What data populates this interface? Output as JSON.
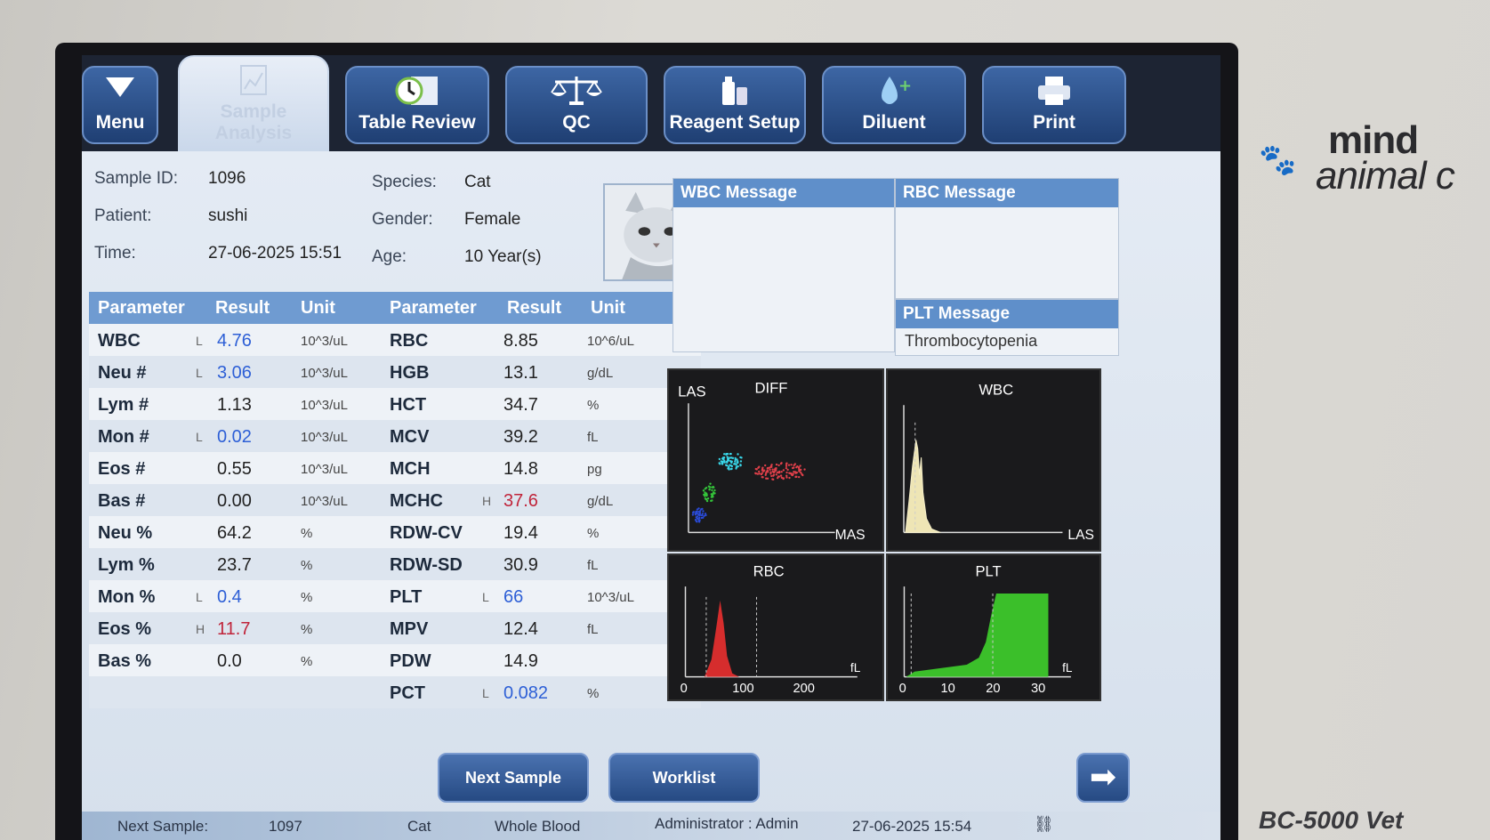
{
  "toolbar": {
    "menu": "Menu",
    "sample_analysis": "Sample Analysis",
    "table_review": "Table Review",
    "qc": "QC",
    "reagent_setup": "Reagent Setup",
    "diluent": "Diluent",
    "print": "Print"
  },
  "sample": {
    "id_label": "Sample ID:",
    "id": "1096",
    "patient_label": "Patient:",
    "patient": "sushi",
    "time_label": "Time:",
    "time": "27-06-2025 15:51",
    "species_label": "Species:",
    "species": "Cat",
    "gender_label": "Gender:",
    "gender": "Female",
    "age_label": "Age:",
    "age": "10 Year(s)"
  },
  "table": {
    "headers": [
      "Parameter",
      "Result",
      "Unit",
      "Parameter",
      "Result",
      "Unit"
    ],
    "left": [
      {
        "param": "WBC",
        "flag": "L",
        "result": "4.76",
        "unit": "10^3/uL",
        "status": "low"
      },
      {
        "param": "Neu #",
        "flag": "L",
        "result": "3.06",
        "unit": "10^3/uL",
        "status": "low"
      },
      {
        "param": "Lym #",
        "flag": "",
        "result": "1.13",
        "unit": "10^3/uL",
        "status": ""
      },
      {
        "param": "Mon #",
        "flag": "L",
        "result": "0.02",
        "unit": "10^3/uL",
        "status": "low"
      },
      {
        "param": "Eos #",
        "flag": "",
        "result": "0.55",
        "unit": "10^3/uL",
        "status": ""
      },
      {
        "param": "Bas #",
        "flag": "",
        "result": "0.00",
        "unit": "10^3/uL",
        "status": ""
      },
      {
        "param": "Neu %",
        "flag": "",
        "result": "64.2",
        "unit": "%",
        "status": ""
      },
      {
        "param": "Lym %",
        "flag": "",
        "result": "23.7",
        "unit": "%",
        "status": ""
      },
      {
        "param": "Mon %",
        "flag": "L",
        "result": "0.4",
        "unit": "%",
        "status": "low"
      },
      {
        "param": "Eos %",
        "flag": "H",
        "result": "11.7",
        "unit": "%",
        "status": "high"
      },
      {
        "param": "Bas %",
        "flag": "",
        "result": "0.0",
        "unit": "%",
        "status": ""
      },
      {
        "param": "",
        "flag": "",
        "result": "",
        "unit": "",
        "status": ""
      }
    ],
    "right": [
      {
        "param": "RBC",
        "flag": "",
        "result": "8.85",
        "unit": "10^6/uL",
        "status": ""
      },
      {
        "param": "HGB",
        "flag": "",
        "result": "13.1",
        "unit": "g/dL",
        "status": ""
      },
      {
        "param": "HCT",
        "flag": "",
        "result": "34.7",
        "unit": "%",
        "status": ""
      },
      {
        "param": "MCV",
        "flag": "",
        "result": "39.2",
        "unit": "fL",
        "status": ""
      },
      {
        "param": "MCH",
        "flag": "",
        "result": "14.8",
        "unit": "pg",
        "status": ""
      },
      {
        "param": "MCHC",
        "flag": "H",
        "result": "37.6",
        "unit": "g/dL",
        "status": "high"
      },
      {
        "param": "RDW-CV",
        "flag": "",
        "result": "19.4",
        "unit": "%",
        "status": ""
      },
      {
        "param": "RDW-SD",
        "flag": "",
        "result": "30.9",
        "unit": "fL",
        "status": ""
      },
      {
        "param": "PLT",
        "flag": "L",
        "result": "66",
        "unit": "10^3/uL",
        "status": "low"
      },
      {
        "param": "MPV",
        "flag": "",
        "result": "12.4",
        "unit": "fL",
        "status": ""
      },
      {
        "param": "PDW",
        "flag": "",
        "result": "14.9",
        "unit": "",
        "status": ""
      },
      {
        "param": "PCT",
        "flag": "L",
        "result": "0.082",
        "unit": "%",
        "status": "low"
      }
    ]
  },
  "messages": {
    "wbc_title": "WBC Message",
    "wbc_text": "",
    "rbc_title": "RBC Message",
    "rbc_text": "",
    "plt_title": "PLT Message",
    "plt_text": "Thrombocytopenia"
  },
  "charts": {
    "diff": {
      "title": "DIFF",
      "y_label": "LAS",
      "x_label": "MAS"
    },
    "wbc": {
      "title": "WBC",
      "x_label": "LAS"
    },
    "rbc": {
      "title": "RBC",
      "x_label": "fL",
      "ticks": [
        "0",
        "100",
        "200"
      ]
    },
    "plt": {
      "title": "PLT",
      "x_label": "fL",
      "ticks": [
        "0",
        "10",
        "20",
        "30"
      ]
    }
  },
  "buttons": {
    "next_sample": "Next Sample",
    "worklist": "Worklist"
  },
  "status": {
    "next_sample_label": "Next Sample:",
    "next_sample_id": "1097",
    "species": "Cat",
    "mode": "Whole Blood",
    "user": "Administrator : Admin",
    "datetime": "27-06-2025 15:54"
  },
  "device": {
    "brand_line1": "mind",
    "brand_line2": "animal c",
    "model": "BC-5000 Vet"
  },
  "colors": {
    "low": "#2d5fd6",
    "high": "#c0243a",
    "toolbar_button": "#2e5594",
    "header": "#6f9bd1"
  }
}
